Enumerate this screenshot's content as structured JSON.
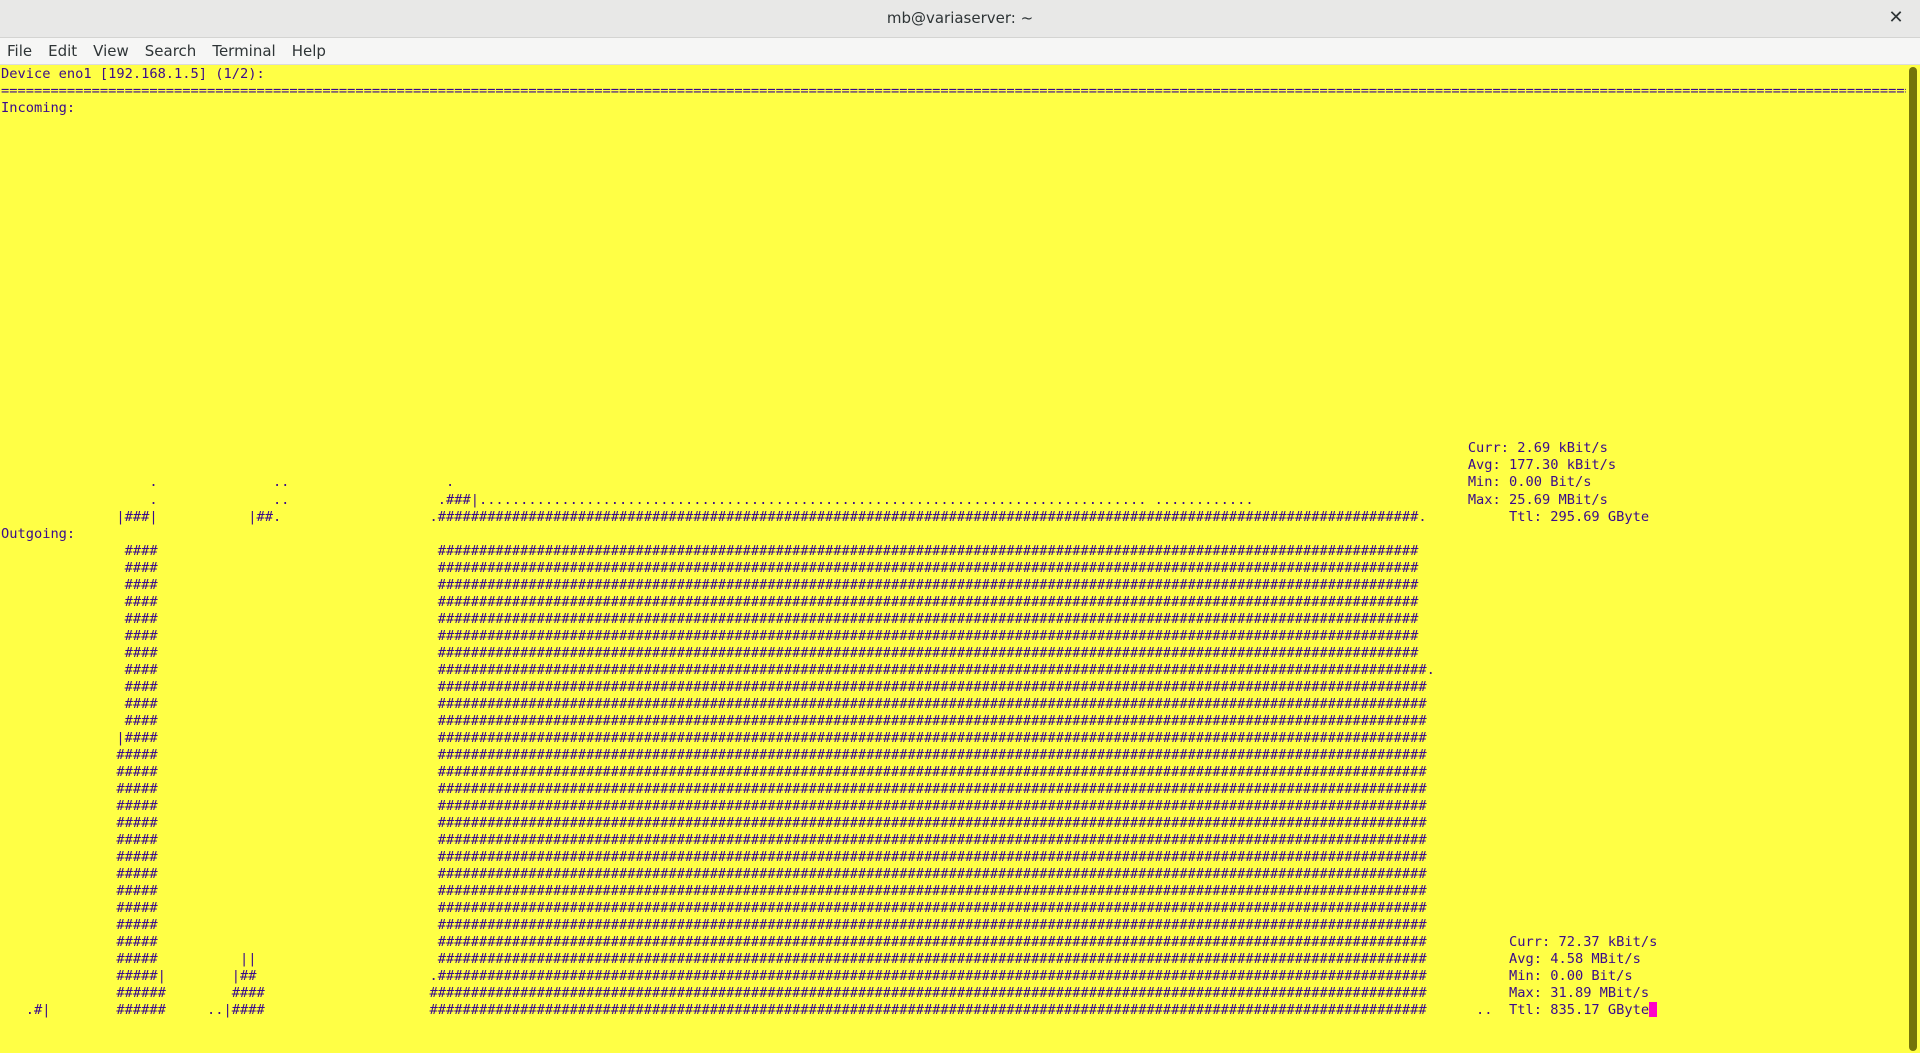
{
  "window": {
    "title": "mb@variaserver: ~",
    "close_glyph": "✕"
  },
  "menubar": {
    "items": [
      "File",
      "Edit",
      "View",
      "Search",
      "Terminal",
      "Help"
    ]
  },
  "colors": {
    "terminal_background": "#ffff45",
    "terminal_foreground": "#3a0a8c",
    "cursor": "#ff00c8"
  },
  "terminal": {
    "lines": [
      "Device eno1 [192.168.1.5] (1/2):",
      "==============================================================================================================================================================================================================================================================================================================================================",
      "Incoming:",
      "",
      "",
      "",
      "",
      "",
      "",
      "",
      "",
      "",
      "",
      "",
      "",
      "",
      "",
      "",
      "",
      "",
      "",
      "",
      "                                                                                                                                                                                  Curr: 2.69 kBit/s",
      "                                                                                                                                                                                  Avg: 177.30 kBit/s",
      "                  .              ..                   .                                                                                                                           Min: 0.00 Bit/s",
      "                  .              ..                  .###|................................................................................. ............                          Max: 25.69 MBit/s",
      "              |###|           |##.                  .#######################################################################################################################.          Ttl: 295.69 GByte",
      "Outgoing:",
      "               ####                                  #######################################################################################################################",
      "               ####                                  #######################################################################################################################",
      "               ####                                  #######################################################################################################################",
      "               ####                                  #######################################################################################################################",
      "               ####                                  #######################################################################################################################",
      "               ####                                  #######################################################################################################################",
      "               ####                                  #######################################################################################################################",
      "               ####                                  ########################################################################################################################.",
      "               ####                                  ########################################################################################################################",
      "               ####                                  ########################################################################################################################",
      "               ####                                  ########################################################################################################################",
      "              |####                                  ########################################################################################################################",
      "              #####                                  ########################################################################################################################",
      "              #####                                  ########################################################################################################################",
      "              #####                                  ########################################################################################################################",
      "              #####                                  ########################################################################################################################",
      "              #####                                  ########################################################################################################################",
      "              #####                                  ########################################################################################################################",
      "              #####                                  ########################################################################################################################",
      "              #####                                  ########################################################################################################################",
      "              #####                                  ########################################################################################################################",
      "              #####                                  ########################################################################################################################",
      "              #####                                  ########################################################################################################################",
      "              #####                                  ########################################################################################################################          Curr: 72.37 kBit/s",
      "              #####          ||                      ########################################################################################################################          Avg: 4.58 MBit/s",
      "              #####|        |##                     .########################################################################################################################          Min: 0.00 Bit/s",
      "              ######        ####                    #########################################################################################################################          Max: 31.89 MBit/s",
      "   .#|        ######     ..|####                    #########################################################################################################################      ..  Ttl: 835.17 GByte"
    ]
  }
}
